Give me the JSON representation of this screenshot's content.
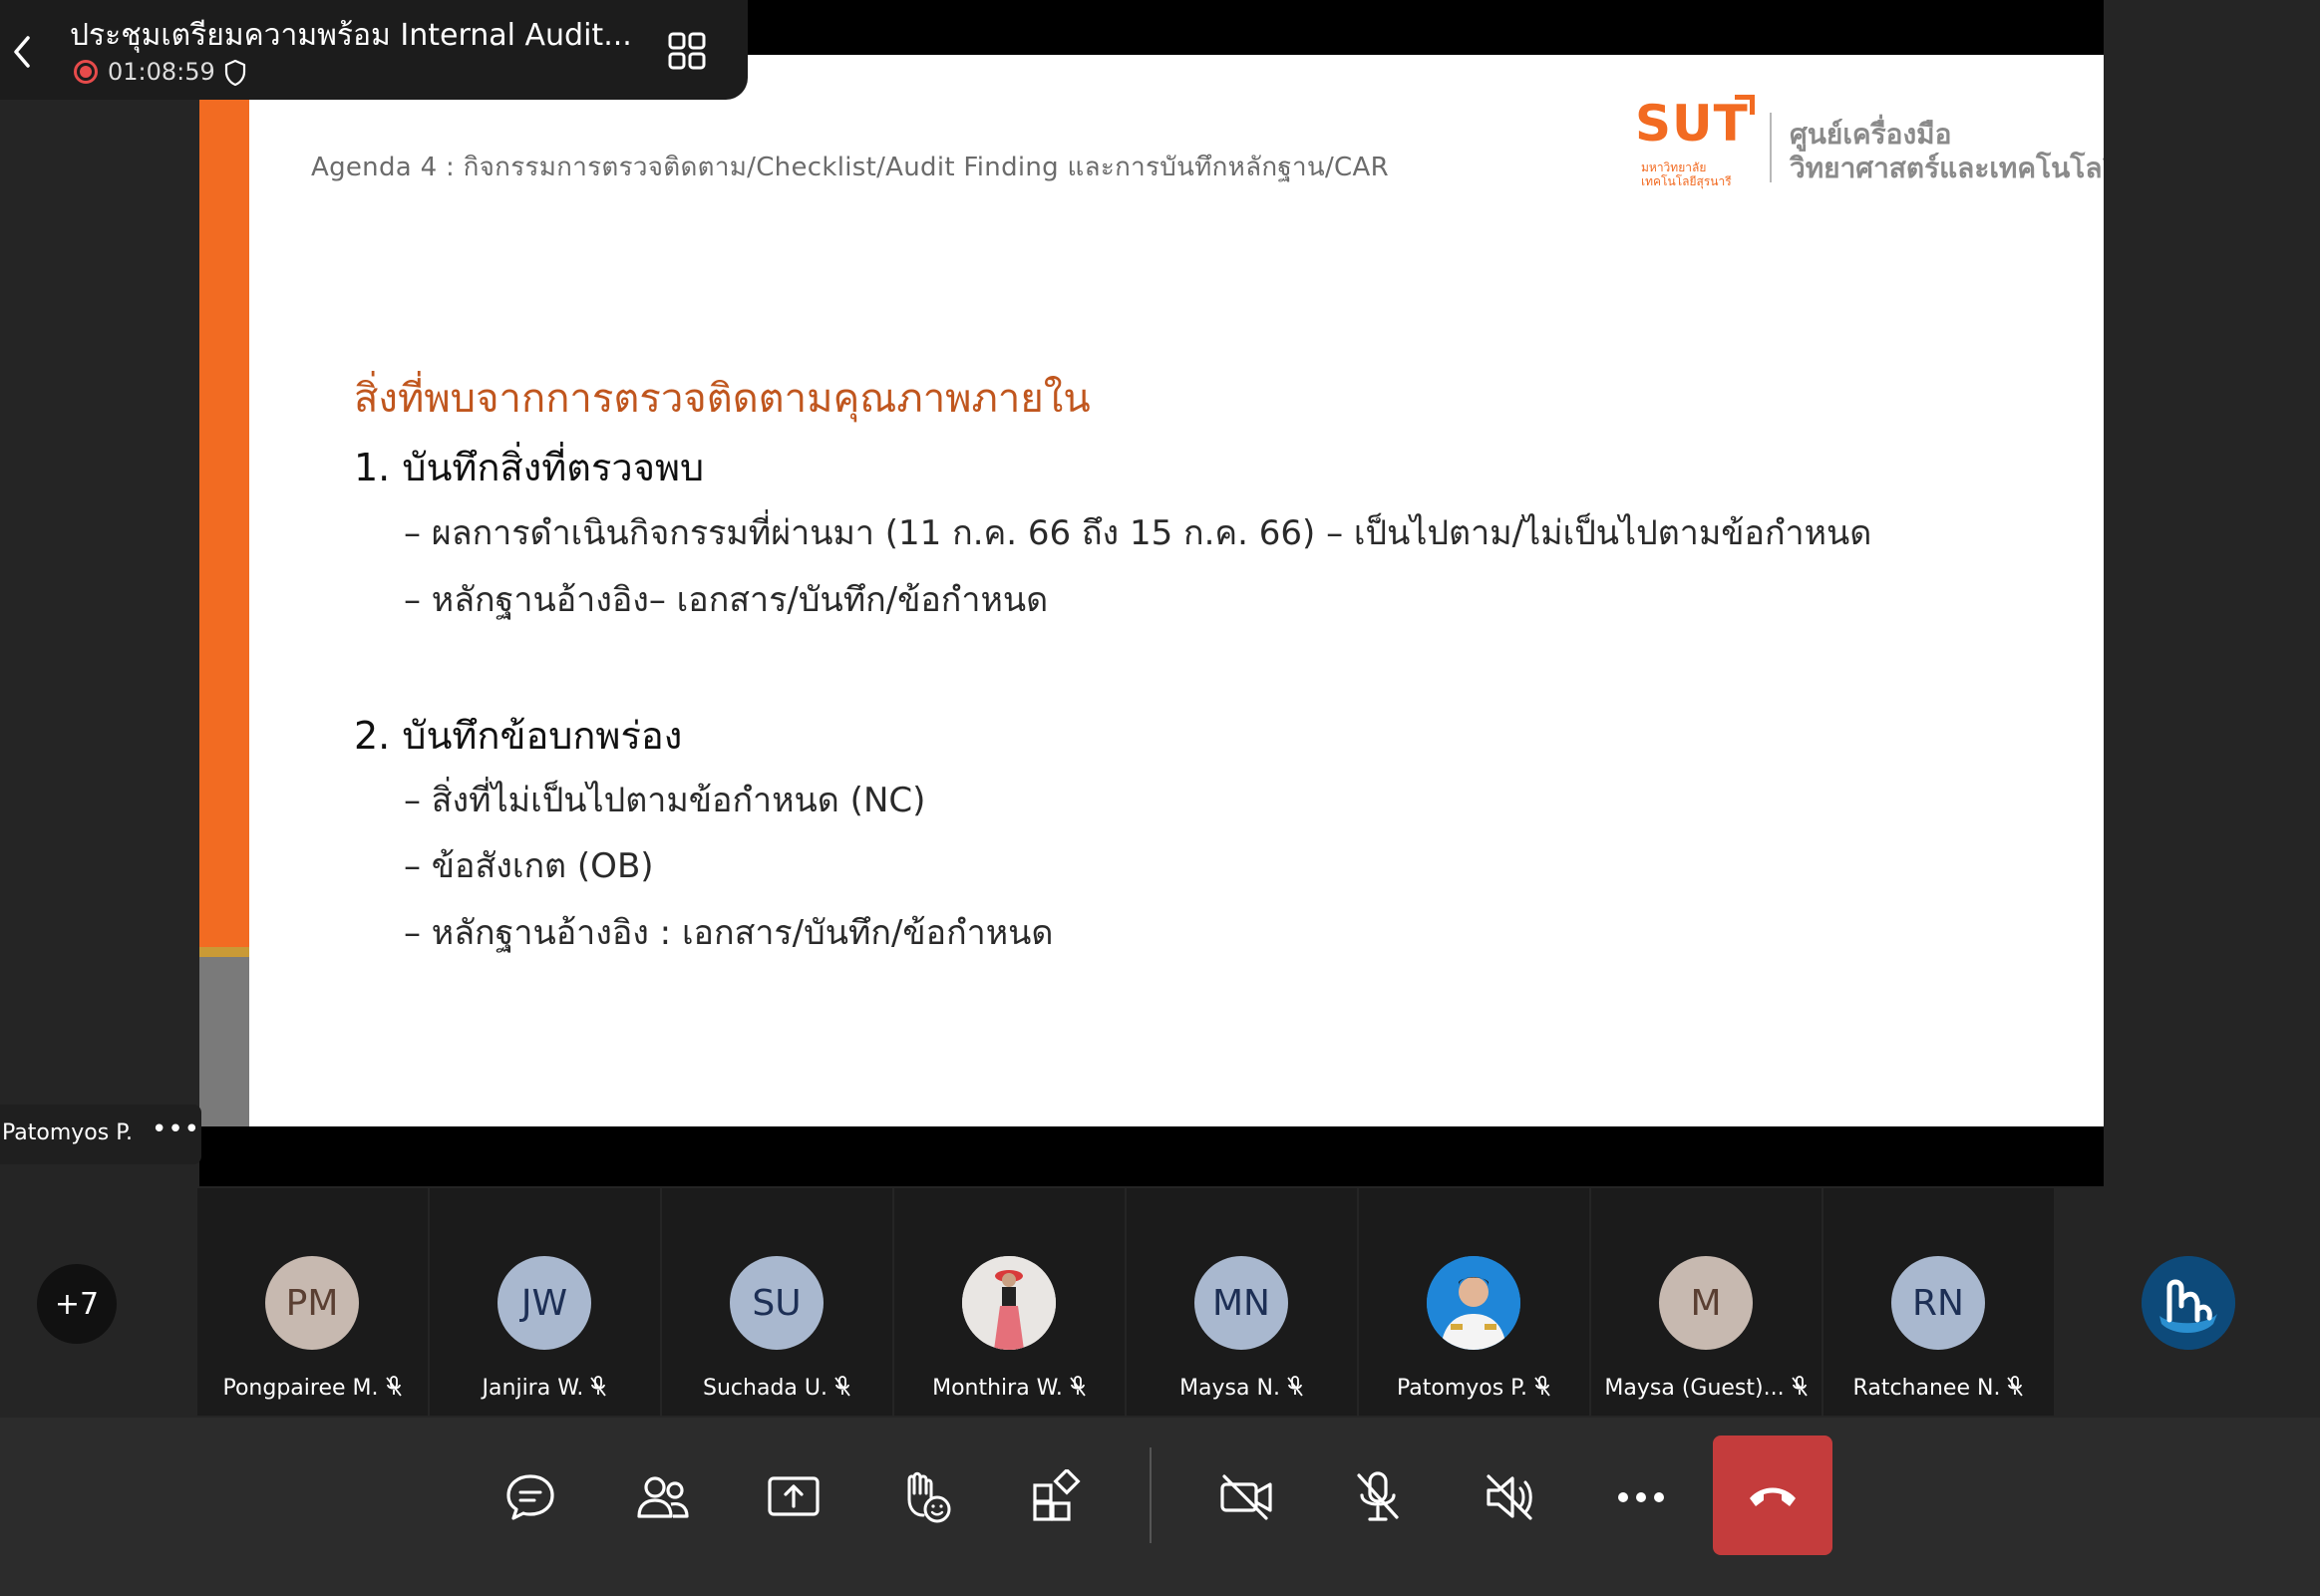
{
  "meeting": {
    "title": "ประชุมเตรียมความพร้อม Internal Audit...",
    "elapsed": "01:08:59"
  },
  "slide": {
    "agenda": "Agenda 4 : กิจกรรมการตรวจติดตาม/Checklist/Audit Finding และการบันทึกหลักฐาน/CAR",
    "logo": {
      "brand": "SUT",
      "sub_line1": "มหาวิทยาลัย",
      "sub_line2": "เทคโนโลยีสุรนารี",
      "name_line1": "ศูนย์เครื่องมือ",
      "name_line2": "วิทยาศาสตร์และเทคโนโลยี"
    },
    "heading": "สิ่งที่พบจากการตรวจติดตามคุณภาพภายใน",
    "section1": "1. บันทึกสิ่งที่ตรวจพบ",
    "s1_items": [
      "– ผลการดำเนินกิจกรรมที่ผ่านมา (11 ก.ค. 66 ถึง 15 ก.ค. 66) – เป็นไปตาม/ไม่เป็นไปตามข้อกำหนด",
      "– หลักฐานอ้างอิง– เอกสาร/บันทึก/ข้อกำหนด"
    ],
    "section2": "2. บันทึกข้อบกพร่อง",
    "s2_items": [
      "– สิ่งที่ไม่เป็นไปตามข้อกำหนด (NC)",
      "– ข้อสังเกต (OB)",
      "– หลักฐานอ้างอิง : เอกสาร/บันทึก/ข้อกำหนด"
    ]
  },
  "presenter": {
    "name": "Patomyos P.",
    "more": "•••"
  },
  "participants": {
    "more_count": "+7",
    "tiles": [
      {
        "initials": "PM",
        "name": "Pongpairee M.",
        "bg": "#c7b9b0",
        "fg": "#5a3f32"
      },
      {
        "initials": "JW",
        "name": "Janjira W.",
        "bg": "#a9b8cf",
        "fg": "#1d2f55"
      },
      {
        "initials": "SU",
        "name": "Suchada U.",
        "bg": "#a9b8cf",
        "fg": "#1d2f55"
      },
      {
        "initials": "",
        "name": "Monthira W.",
        "bg": "#e7e4e1",
        "fg": "#333"
      },
      {
        "initials": "MN",
        "name": "Maysa N.",
        "bg": "#a9b8cf",
        "fg": "#1d2f55"
      },
      {
        "initials": "",
        "name": "Patomyos P.",
        "bg": "#1f86d8",
        "fg": "#fff"
      },
      {
        "initials": "M",
        "name": "Maysa (Guest)...",
        "bg": "#c7b9b0",
        "fg": "#5a3f32"
      },
      {
        "initials": "RN",
        "name": "Ratchanee N.",
        "bg": "#a9b8cf",
        "fg": "#1d2f55"
      },
      {
        "initials": "",
        "name": "",
        "bg": "#0d4a7a",
        "fg": "#fff"
      }
    ]
  },
  "colors": {
    "accent_orange": "#f26b22",
    "end_call": "#c43c3c",
    "record": "#e74b4b"
  }
}
